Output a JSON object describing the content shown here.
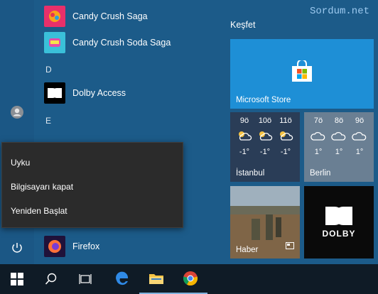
{
  "watermark": "Sordum.net",
  "app_list": {
    "items": [
      {
        "label": "Candy Crush Saga",
        "icon": "candy-crush-saga-icon"
      },
      {
        "label": "Candy Crush Soda Saga",
        "icon": "candy-crush-soda-icon"
      },
      {
        "label": "Dolby Access",
        "icon": "dolby-access-icon"
      },
      {
        "label": "Firefox",
        "icon": "firefox-icon"
      }
    ],
    "groups": [
      "D",
      "E"
    ]
  },
  "tiles": {
    "section_title": "Keşfet",
    "store_label": "Microsoft Store",
    "istanbul": {
      "label": "İstanbul",
      "hours": [
        "9ö",
        "10ö",
        "11ö"
      ],
      "temps": [
        "-1°",
        "-1°",
        "-1°"
      ]
    },
    "berlin": {
      "label": "Berlin",
      "hours": [
        "7ö",
        "8ö",
        "9ö"
      ],
      "temps": [
        "1°",
        "1°",
        "1°"
      ]
    },
    "news_label": "Haber",
    "dolby_logo_text": "DOLBY"
  },
  "power_menu": {
    "items": [
      "Uyku",
      "Bilgisayarı kapat",
      "Yeniden Başlat"
    ]
  },
  "colors": {
    "accent": "#1e8fd6",
    "start_bg": "#1c5b89",
    "taskbar_bg": "#0f1b26",
    "menu_bg": "#2b2b2b"
  }
}
